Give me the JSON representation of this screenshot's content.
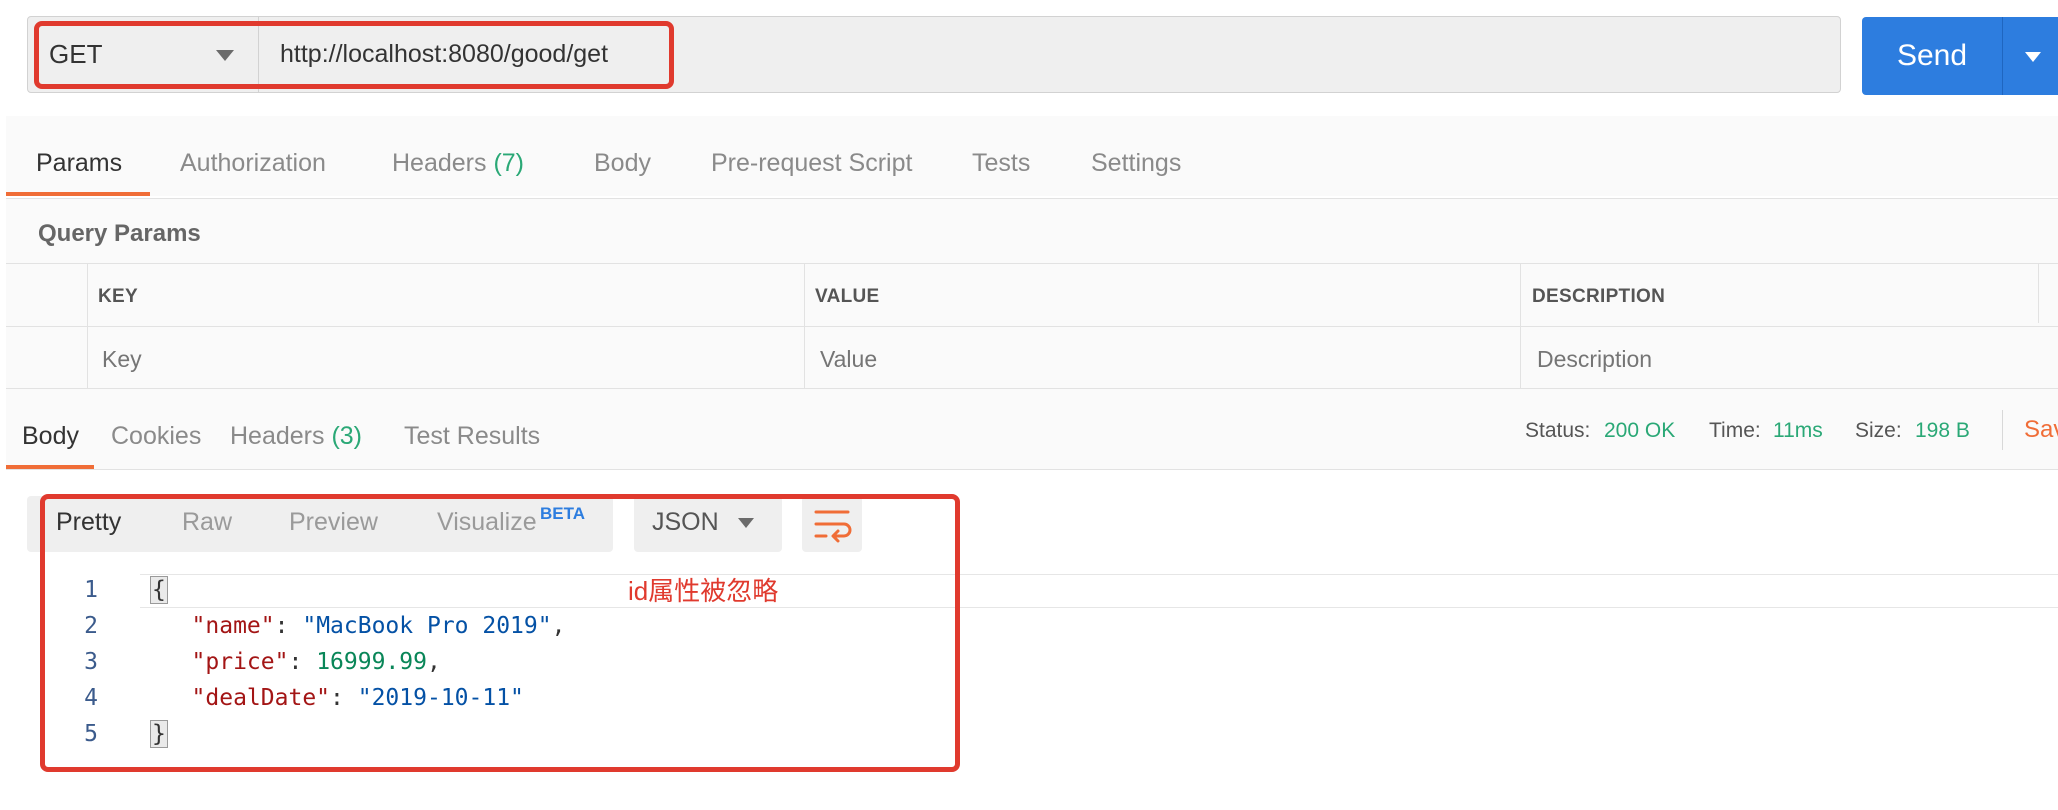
{
  "request": {
    "method": "GET",
    "url": "http://localhost:8080/good/get",
    "send_label": "Send"
  },
  "request_tabs": [
    {
      "label": "Params"
    },
    {
      "label": "Authorization"
    },
    {
      "label": "Headers",
      "count": "(7)"
    },
    {
      "label": "Body"
    },
    {
      "label": "Pre-request Script"
    },
    {
      "label": "Tests"
    },
    {
      "label": "Settings"
    }
  ],
  "query_params": {
    "title": "Query Params",
    "columns": [
      "KEY",
      "VALUE",
      "DESCRIPTION"
    ],
    "placeholders": [
      "Key",
      "Value",
      "Description"
    ]
  },
  "response_tabs": [
    {
      "label": "Body"
    },
    {
      "label": "Cookies"
    },
    {
      "label": "Headers",
      "count": "(3)"
    },
    {
      "label": "Test Results"
    }
  ],
  "response_meta": {
    "status_label": "Status:",
    "status_value": "200 OK",
    "time_label": "Time:",
    "time_value": "11ms",
    "size_label": "Size:",
    "size_value": "198 B",
    "save_label": "Sav"
  },
  "view_modes": [
    "Pretty",
    "Raw",
    "Preview",
    "Visualize"
  ],
  "beta_label": "BETA",
  "format": "JSON",
  "code": {
    "line_numbers": [
      "1",
      "2",
      "3",
      "4",
      "5"
    ],
    "open": "{",
    "close": "}",
    "name_key": "\"name\"",
    "name_value": "\"MacBook Pro 2019\"",
    "price_key": "\"price\"",
    "price_value": "16999.99",
    "date_key": "\"dealDate\"",
    "date_value": "\"2019-10-11\""
  },
  "annotation": "id属性被忽略",
  "colors": {
    "accent_orange": "#f06d37",
    "send_blue": "#2d7ddf",
    "success_green": "#2aa876",
    "annotation_red": "#e03a2e"
  }
}
